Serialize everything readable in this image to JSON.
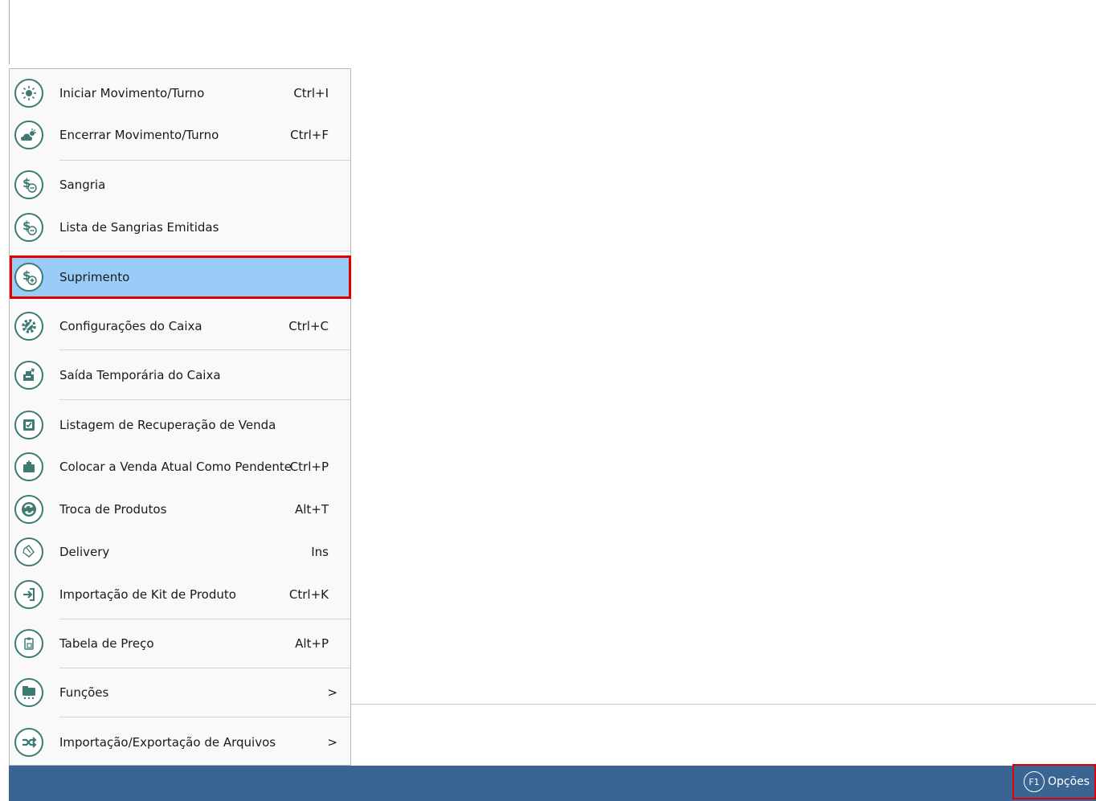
{
  "menu": {
    "items": [
      {
        "label": "Iniciar Movimento/Turno",
        "shortcut": "Ctrl+I",
        "icon": "sun-icon"
      },
      {
        "label": "Encerrar Movimento/Turno",
        "shortcut": "Ctrl+F",
        "icon": "cloud-sun-icon"
      },
      {
        "label": "Sangria",
        "shortcut": "",
        "icon": "dollar-minus-icon"
      },
      {
        "label": "Lista de Sangrias Emitidas",
        "shortcut": "",
        "icon": "dollar-minus-icon"
      },
      {
        "label": "Suprimento",
        "shortcut": "",
        "icon": "dollar-plus-icon"
      },
      {
        "label": "Configurações do Caixa",
        "shortcut": "Ctrl+C",
        "icon": "gear-wrench-icon"
      },
      {
        "label": "Saída Temporária do Caixa",
        "shortcut": "",
        "icon": "exit-register-icon"
      },
      {
        "label": "Listagem de Recuperação de Venda",
        "shortcut": "",
        "icon": "checklist-icon"
      },
      {
        "label": "Colocar a Venda Atual Como Pendente",
        "shortcut": "Ctrl+P",
        "icon": "pending-sale-icon"
      },
      {
        "label": "Troca de Produtos",
        "shortcut": "Alt+T",
        "icon": "exchange-icon"
      },
      {
        "label": "Delivery",
        "shortcut": "Ins",
        "icon": "delivery-icon"
      },
      {
        "label": "Importação de Kit de Produto",
        "shortcut": "Ctrl+K",
        "icon": "import-icon"
      },
      {
        "label": "Tabela de Preço",
        "shortcut": "Alt+P",
        "icon": "price-table-icon"
      },
      {
        "label": "Funções",
        "shortcut": ">",
        "icon": "functions-icon"
      },
      {
        "label": "Importação/Exportação de Arquivos",
        "shortcut": ">",
        "icon": "shuffle-icon"
      }
    ]
  },
  "statusbar": {
    "options_key": "F1",
    "options_label": "Opções"
  },
  "colors": {
    "icon_accent": "#3d7a73",
    "selected_bg": "#99ccf7",
    "highlight_border": "#e00000",
    "statusbar_bg": "#3a6593"
  }
}
